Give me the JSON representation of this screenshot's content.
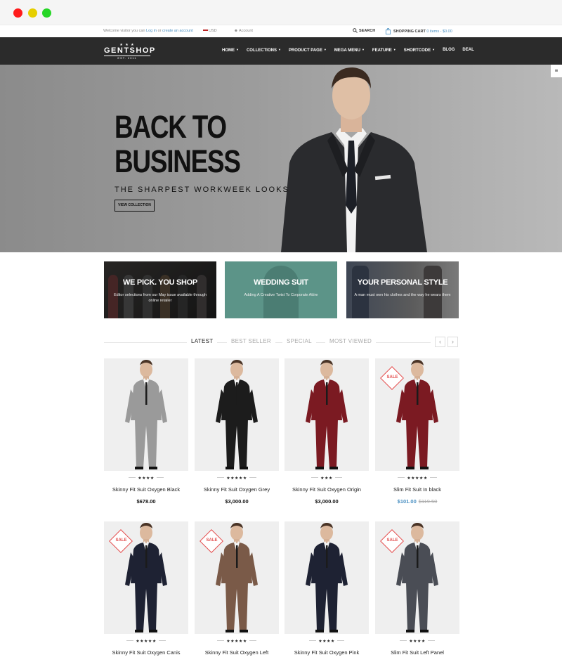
{
  "topbar": {
    "welcome_prefix": "Welcome visitor you can",
    "login_link": "Log in",
    "or_text": "or",
    "create_link": "create an account",
    "currency": "USD",
    "account": "Account",
    "search": "SEARCH",
    "cart_label": "SHOPPING CART",
    "cart_summary": "0 items - $0.00"
  },
  "logo": {
    "stars": "★ ★ ★",
    "name": "GENTSHOP",
    "est": "EST. 2011"
  },
  "nav": {
    "items": [
      {
        "label": "HOME",
        "dropdown": true
      },
      {
        "label": "COLLECTIONS",
        "dropdown": true
      },
      {
        "label": "PRODUCT PAGE",
        "dropdown": true
      },
      {
        "label": "MEGA MENU",
        "dropdown": true
      },
      {
        "label": "FEATURE",
        "dropdown": true
      },
      {
        "label": "SHORTCODE",
        "dropdown": true
      },
      {
        "label": "BLOG",
        "dropdown": false
      },
      {
        "label": "DEAL",
        "dropdown": false
      }
    ]
  },
  "hero": {
    "title_line1": "BACK TO",
    "title_line2": "BUSINESS",
    "subtitle": "THE SHARPEST WORKWEEK LOOKS",
    "button": "VIEW COLLECTION"
  },
  "banners": [
    {
      "title": "WE PICK. YOU SHOP",
      "desc": "Editor selections from our May issue available through online retailer"
    },
    {
      "title": "WEDDING SUIT",
      "desc": "Adding A Creative Twist To Corporate Attire"
    },
    {
      "title": "YOUR PERSONAL STYLE",
      "desc": "A man must own his clothes and the way he wears them"
    }
  ],
  "tabs": [
    "LATEST",
    "BEST SELLER",
    "SPECIAL",
    "MOST VIEWED"
  ],
  "sale_label": "SALE",
  "products": [
    {
      "name": "Skinny Fit Suit Oxygen Black",
      "price": "$678.00",
      "rating": 4,
      "sale": false,
      "suit": "#9a9a9a"
    },
    {
      "name": "Skinny Fit Suit Oxygen Grey",
      "price": "$3,000.00",
      "rating": 5,
      "sale": false,
      "suit": "#1c1c1c"
    },
    {
      "name": "Skinny Fit Suit Oxygen Origin",
      "price": "$3,000.00",
      "rating": 3,
      "sale": false,
      "suit": "#7b1a22"
    },
    {
      "name": "Slim Fit Suit In black",
      "price": "$101.00",
      "old_price": "$119.50",
      "rating": 5,
      "sale": true,
      "suit": "#7b1a22"
    },
    {
      "name": "Skinny Fit Suit Oxygen Canis",
      "price": "",
      "rating": 5,
      "sale": true,
      "suit": "#1e2233"
    },
    {
      "name": "Skinny Fit Suit Oxygen Left",
      "price": "",
      "rating": 5,
      "sale": true,
      "suit": "#7a5a48"
    },
    {
      "name": "Skinny Fit Suit Oxygen Pink",
      "price": "",
      "rating": 4,
      "sale": false,
      "suit": "#1e2233"
    },
    {
      "name": "Slim Fit Suit Left Panel",
      "price": "",
      "rating": 4,
      "sale": true,
      "suit": "#4a4d55"
    }
  ],
  "colors": {
    "nav_bg": "#2b2b2b",
    "accent_blue": "#4a90c2",
    "sale_red": "#e34b4b"
  }
}
